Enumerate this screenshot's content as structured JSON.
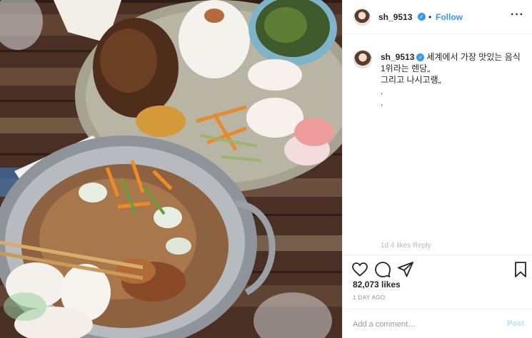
{
  "post": {
    "username": "sh_9513",
    "verified_glyph": "✓",
    "follow_label": "Follow",
    "separator": "•",
    "more_glyph": "···"
  },
  "caption": {
    "username": "sh_9513",
    "text": "세계에서 가장 맛있는 음식 1위라는 렌당„\n그리고 나시고랭„\n.\n.",
    "ghost_meta": "1d   4 likes   Reply"
  },
  "actions": {
    "like_icon": "heart-icon",
    "comment_icon": "comment-icon",
    "share_icon": "share-icon",
    "save_icon": "bookmark-icon"
  },
  "likes": "82,073 likes",
  "time": "1 DAY AGO",
  "comment_box": {
    "placeholder": "Add a comment…",
    "post_label": "Post"
  },
  "colors": {
    "accent": "#3897f0",
    "post_disabled": "#b2dffc"
  }
}
